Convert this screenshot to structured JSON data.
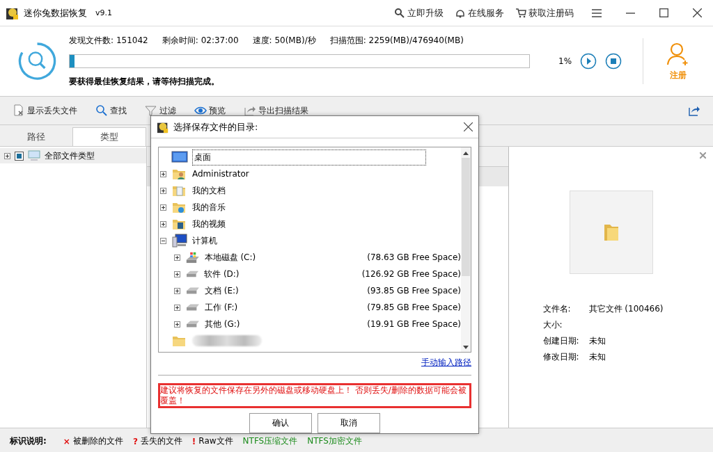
{
  "window": {
    "title": "迷你兔数据恢复",
    "version": "v9.1",
    "actions": [
      {
        "kind": "upgrade",
        "label": "立即升级"
      },
      {
        "kind": "service",
        "label": "在线服务"
      },
      {
        "kind": "cart",
        "label": "获取注册码"
      }
    ]
  },
  "scan": {
    "stats": [
      {
        "label": "发现文件数:",
        "value": "151042"
      },
      {
        "label": "剩余时间:",
        "value": "02:37:00"
      },
      {
        "label": "速度:",
        "value": "50(MB)/秒"
      },
      {
        "label": "扫描范围:",
        "value": "2259(MB)/476940(MB)"
      }
    ],
    "level": 0.01,
    "percent": "1%",
    "hint": "要获得最佳恢复结果，请等待扫描完成。",
    "register": "注册"
  },
  "toolbar": [
    {
      "kind": "show-lost",
      "label": "显示丢失文件"
    },
    {
      "kind": "find",
      "label": "查找"
    },
    {
      "kind": "filter",
      "label": "过滤"
    },
    {
      "kind": "preview",
      "label": "预览"
    },
    {
      "kind": "export",
      "label": "导出扫描结果"
    }
  ],
  "tabs": [
    {
      "label": "路径",
      "selected": false
    },
    {
      "label": "类型",
      "selected": true
    }
  ],
  "type_tree": [
    {
      "label": "全部文件类型",
      "expanded": false
    }
  ],
  "preview": {
    "info": [
      {
        "label": "文件名:",
        "value": "其它文件 (100466)"
      },
      {
        "label": "大小:"
      },
      {
        "label": "创建日期:",
        "value": "未知"
      },
      {
        "label": "修改日期:",
        "value": "未知"
      }
    ]
  },
  "legend": {
    "title": "标识说明:",
    "items": [
      {
        "marker": "×",
        "label": "被删除的文件"
      },
      {
        "marker": "?",
        "label": "丢失的文件"
      },
      {
        "marker": "!",
        "label": "Raw文件"
      },
      {
        "label": "NTFS压缩文件",
        "color": "#1a8a1a"
      },
      {
        "label": "NTFS加密文件",
        "color": "#1a8a1a"
      }
    ]
  },
  "dialog": {
    "title": "选择保存文件的目录:",
    "tree": {
      "label": "桌面",
      "kind": "desktop",
      "selected": true,
      "children": [
        {
          "label": "Administrator",
          "kind": "user-folder",
          "expanded": false
        },
        {
          "label": "我的文档",
          "kind": "docs-folder",
          "expanded": false
        },
        {
          "label": "我的音乐",
          "kind": "music-folder",
          "expanded": false
        },
        {
          "label": "我的视频",
          "kind": "video-folder",
          "expanded": false
        },
        {
          "label": "计算机",
          "kind": "computer",
          "expanded": true,
          "children": [
            {
              "label": "本地磁盘 (C:)",
              "kind": "system-drive",
              "free": "(78.63 GB Free Space)",
              "expanded": false
            },
            {
              "label": "软件 (D:)",
              "kind": "drive",
              "free": "(126.92 GB Free Space)",
              "expanded": false
            },
            {
              "label": "文档 (E:)",
              "kind": "drive",
              "free": "(93.85 GB Free Space)",
              "expanded": false
            },
            {
              "label": "工作 (F:)",
              "kind": "drive",
              "free": "(79.85 GB Free Space)",
              "expanded": false
            },
            {
              "label": "其他 (G:)",
              "kind": "drive",
              "free": "(19.91 GB Free Space)",
              "expanded": false
            }
          ]
        },
        {
          "kind": "redacted-folder"
        }
      ]
    },
    "link": "手动输入路径",
    "warning": "建议将恢复的文件保存在另外的磁盘或移动硬盘上！ 否则丢失/删除的数据可能会被覆盖！",
    "buttons": [
      "确认",
      "取消"
    ]
  }
}
